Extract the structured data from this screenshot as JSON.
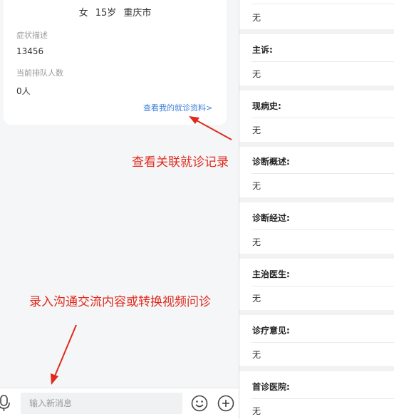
{
  "patient": {
    "gender": "女",
    "age": "15岁",
    "city": "重庆市",
    "symptom_label": "症状描述",
    "symptom_value": "13456",
    "queue_label": "当前排队人数",
    "queue_value": "0人",
    "view_link": "查看我的就诊资料>"
  },
  "annotations": {
    "related_records": "查看关联就诊记录",
    "input_hint": "录入沟通交流内容或转换视频问诊"
  },
  "input": {
    "placeholder": "输入新消息"
  },
  "icons": {
    "mic": "microphone-icon",
    "emoji": "emoji-icon",
    "add": "plus-icon"
  },
  "colors": {
    "annotation": "#e02a1d",
    "link": "#3d7fd9"
  },
  "record": {
    "top_value": "无",
    "fields": [
      {
        "label": "主诉:",
        "value": "无"
      },
      {
        "label": "现病史:",
        "value": "无"
      },
      {
        "label": "诊断概述:",
        "value": "无"
      },
      {
        "label": "诊断经过:",
        "value": "无"
      },
      {
        "label": "主治医生:",
        "value": "无"
      },
      {
        "label": "诊疗意见:",
        "value": "无"
      },
      {
        "label": "首诊医院:",
        "value": "无"
      }
    ]
  }
}
